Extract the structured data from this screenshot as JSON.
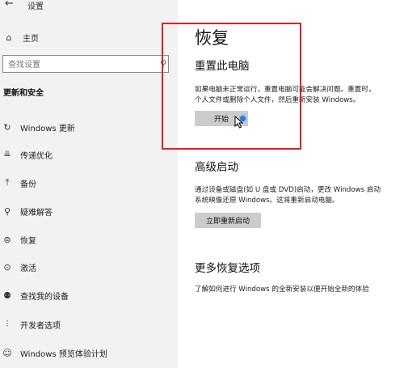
{
  "titlebar": {
    "back_glyph": "←",
    "title": "设置"
  },
  "sidebar": {
    "home": {
      "icon": "home-icon",
      "glyph": "⌂",
      "label": "主页"
    },
    "search": {
      "placeholder": "查找设置"
    },
    "section_heading": "更新和安全",
    "items": [
      {
        "icon": "refresh-icon",
        "glyph": "↻",
        "label": "Windows 更新"
      },
      {
        "icon": "delivery-optimization-icon",
        "glyph": "≞",
        "label": "传递优化"
      },
      {
        "icon": "backup-icon",
        "glyph": "⤒",
        "label": "备份"
      },
      {
        "icon": "wrench-icon",
        "glyph": "⚲",
        "label": "疑难解答"
      },
      {
        "icon": "recovery-icon",
        "glyph": "⊜",
        "label": "恢复"
      },
      {
        "icon": "activation-icon",
        "glyph": "⊙",
        "label": "激活"
      },
      {
        "icon": "find-device-icon",
        "glyph": "⚉",
        "label": "查找我的设备"
      },
      {
        "icon": "developer-icon",
        "glyph": "⫶",
        "label": "开发者选项"
      },
      {
        "icon": "insider-icon",
        "glyph": "☺",
        "label": "Windows 预览体验计划"
      }
    ]
  },
  "main": {
    "title": "恢复",
    "reset": {
      "heading": "重置此电脑",
      "desc_line1": "如果电脑未正常运行，重置电脑可能会解决问题。重置时，",
      "desc_line2": "个人文件或删除个人文件，然后重新安装 Windows。",
      "button": "开始"
    },
    "advanced": {
      "heading": "高级启动",
      "desc_line1": "通过设备或磁盘(如 U 盘或 DVD)启动，更改 Windows 启动",
      "desc_line2": "系统映像还原 Windows。这将重新启动电脑。",
      "button": "立即重新启动"
    },
    "more": {
      "heading": "更多恢复选项",
      "link": "了解如何进行 Windows 的全新安装以便开始全新的体验"
    }
  },
  "colors": {
    "highlight": "#e51e1e",
    "sidebar_bg": "#f2f2f2",
    "button_bg": "#cccccc",
    "cursor_ring": "#2e7bd6"
  }
}
